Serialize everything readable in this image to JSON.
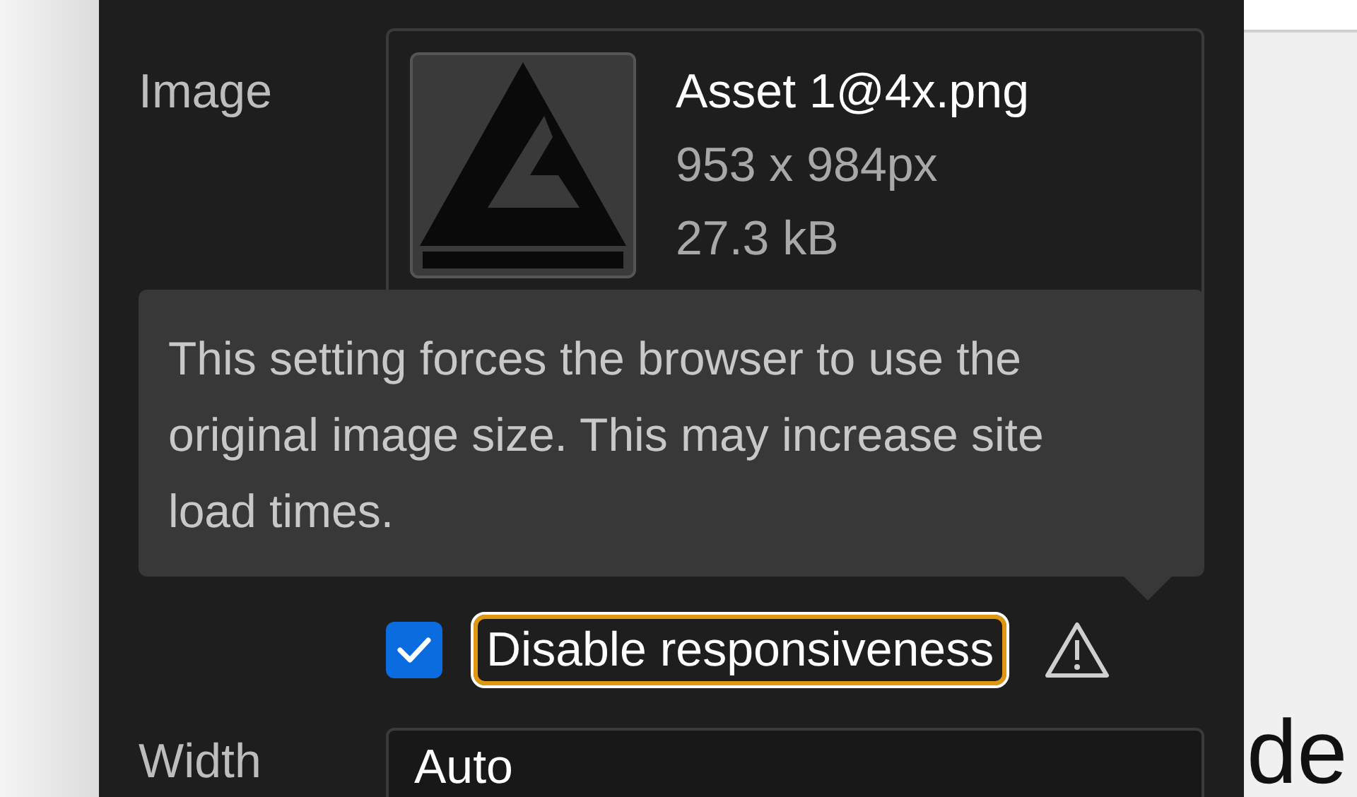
{
  "image_setting": {
    "label": "Image",
    "file_name": "Asset 1@4x.png",
    "dimensions": "953 x 984px",
    "file_size": "27.3 kB"
  },
  "tooltip": {
    "text": "This setting forces the browser to use the original image size. This may increase site load times."
  },
  "responsive_option": {
    "label": "Disable responsiveness",
    "checked": true,
    "focused": true
  },
  "width_setting": {
    "label": "Width",
    "value": "Auto"
  },
  "canvas_text": "de"
}
